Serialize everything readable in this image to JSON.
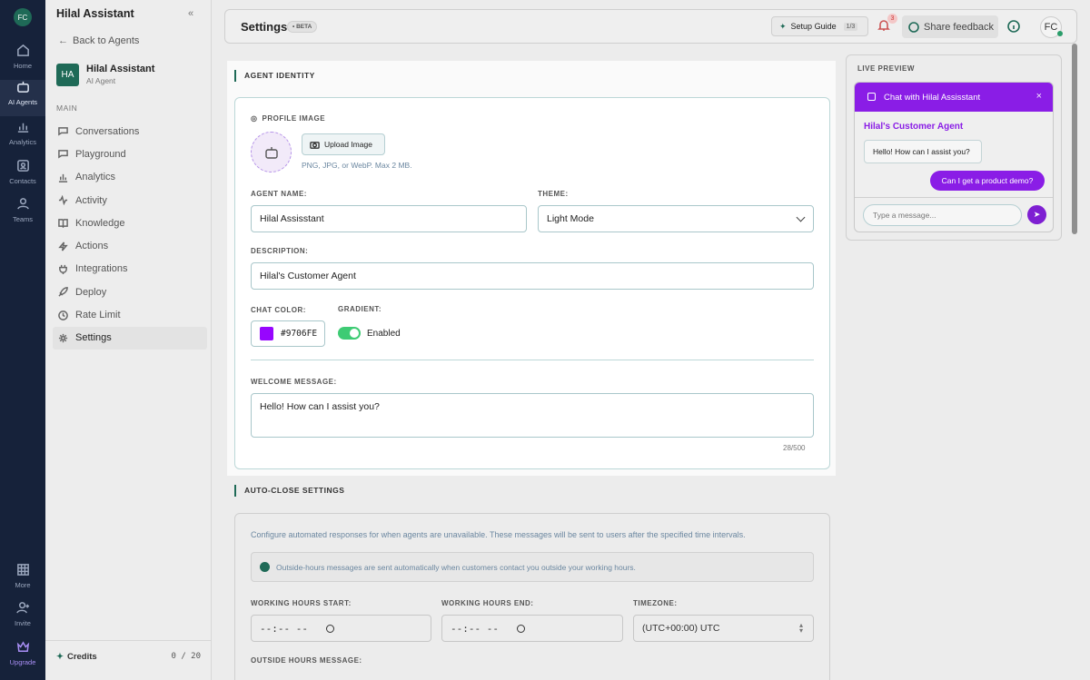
{
  "rail": {
    "logo": "FC",
    "items": [
      {
        "label": "Home",
        "icon": "home-icon"
      },
      {
        "label": "AI Agents",
        "icon": "bot-icon"
      },
      {
        "label": "Analytics",
        "icon": "chart-icon"
      },
      {
        "label": "Contacts",
        "icon": "contacts-icon"
      },
      {
        "label": "Teams",
        "icon": "teams-icon"
      }
    ],
    "bottom_items": [
      {
        "label": "More",
        "icon": "grid-icon"
      },
      {
        "label": "Invite",
        "icon": "invite-icon"
      },
      {
        "label": "Upgrade",
        "icon": "crown-icon"
      }
    ]
  },
  "sidebar": {
    "title": "Hilal Assistant",
    "back_label": "Back to Agents",
    "agent_initials": "HA",
    "agent_name": "Hilal Assistant",
    "agent_type": "AI Agent",
    "section_label": "MAIN",
    "nav": [
      {
        "label": "Conversations",
        "icon": "chat-icon"
      },
      {
        "label": "Playground",
        "icon": "chat-icon"
      },
      {
        "label": "Analytics",
        "icon": "bar-chart-icon"
      },
      {
        "label": "Activity",
        "icon": "activity-icon"
      },
      {
        "label": "Knowledge",
        "icon": "book-icon"
      },
      {
        "label": "Actions",
        "icon": "bolt-icon"
      },
      {
        "label": "Integrations",
        "icon": "plug-icon"
      },
      {
        "label": "Deploy",
        "icon": "rocket-icon"
      },
      {
        "label": "Rate Limit",
        "icon": "clock-icon"
      },
      {
        "label": "Settings",
        "icon": "gear-icon"
      }
    ],
    "credits_label": "Credits",
    "credits_value": "0 / 20"
  },
  "header": {
    "title": "Settings",
    "beta": "• BETA",
    "setup_guide": "Setup Guide",
    "setup_progress": "1/3",
    "notifications": "3",
    "share_feedback": "Share feedback",
    "avatar": "FC"
  },
  "identity": {
    "section": "AGENT IDENTITY",
    "profile_image_label": "PROFILE IMAGE",
    "upload_label": "Upload Image",
    "upload_hint": "PNG, JPG, or WebP. Max 2 MB.",
    "agent_name_label": "AGENT NAME:",
    "agent_name": "Hilal Assisstant",
    "theme_label": "THEME:",
    "theme": "Light Mode",
    "description_label": "DESCRIPTION:",
    "description": "Hilal's Customer Agent",
    "chat_color_label": "CHAT COLOR:",
    "chat_color": "#9706FE",
    "gradient_label": "GRADIENT:",
    "gradient_state": "Enabled",
    "welcome_label": "WELCOME MESSAGE:",
    "welcome_message": "Hello! How can I assist you?",
    "char_count": "28/500"
  },
  "auto_close": {
    "section": "AUTO-CLOSE SETTINGS",
    "intro": "Configure automated responses for when agents are unavailable. These messages will be sent to users after the specified time intervals.",
    "info": "Outside-hours messages are sent automatically when customers contact you outside your working hours.",
    "start_label": "WORKING HOURS START:",
    "start_value": "--:-- --",
    "end_label": "WORKING HOURS END:",
    "end_value": "--:-- --",
    "timezone_label": "TIMEZONE:",
    "timezone": "(UTC+00:00) UTC",
    "outside_label": "OUTSIDE HOURS MESSAGE:"
  },
  "preview": {
    "label": "LIVE PREVIEW",
    "chat_title": "Chat with Hilal Assisstant",
    "agent_name": "Hilal's Customer Agent",
    "welcome": "Hello! How can I assist you?",
    "user_message": "Can I get a product demo?",
    "input_placeholder": "Type a message..."
  },
  "colors": {
    "accent": "#1f6a57",
    "chat": "#9706FE",
    "rail_bg": "#16223a"
  }
}
